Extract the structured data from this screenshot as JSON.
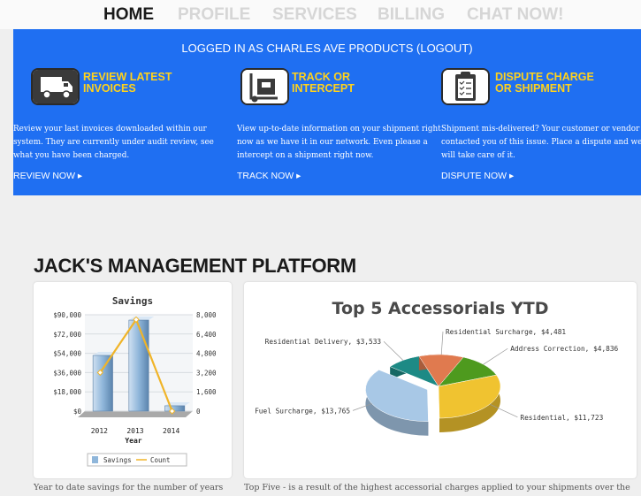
{
  "nav": {
    "items": [
      "HOME",
      "PROFILE",
      "SERVICES",
      "BILLING",
      "CHAT NOW!"
    ]
  },
  "band": {
    "logged_in_text": "LOGGED IN AS CHARLES AVE PRODUCTS (",
    "logout_label": "LOGOUT",
    "logged_in_end": ")",
    "columns": [
      {
        "icon": "delivery-truck-icon",
        "title_line1": "REVIEW LATEST",
        "title_line2": "INVOICES",
        "desc": "Review your last invoices downloaded within our system.  They are currently under audit review, see what you have been charged.",
        "link": "REVIEW NOW ▸"
      },
      {
        "icon": "hand-truck-icon",
        "title_line1": "TRACK OR",
        "title_line2": "INTERCEPT",
        "desc": "View up-to-date information on your shipment right now as we have it in our network.  Even please a intercept on a shipment right now.",
        "link": "TRACK NOW ▸"
      },
      {
        "icon": "clipboard-checklist-icon",
        "title_line1": "DISPUTE CHARGE",
        "title_line2": "OR SHIPMENT",
        "desc": "Shipment mis-delivered?  Your customer or vendor contacted you of this issue.  Place a dispute and we will take care of it.",
        "link": "DISPUTE NOW ▸"
      }
    ]
  },
  "platform_title": "JACK'S MANAGEMENT  PLATFORM",
  "colors": {
    "blue": "#1f6ff2",
    "yellow": "#ffd21c",
    "bar": "#8fb6da",
    "line": "#f0b428"
  },
  "chart_data": [
    {
      "type": "bar",
      "title": "Savings",
      "xlabel": "Year",
      "categories": [
        "2012",
        "2013",
        "2014"
      ],
      "y_left_ticks": [
        "$90,000",
        "$72,000",
        "$54,000",
        "$36,000",
        "$18,000",
        "$0"
      ],
      "y_right_ticks": [
        "8,000",
        "6,400",
        "4,800",
        "3,200",
        "1,600",
        "0"
      ],
      "ylim": [
        0,
        90000
      ],
      "y2lim": [
        0,
        8000
      ],
      "series": [
        {
          "name": "Savings",
          "values": [
            52000,
            85000,
            5000
          ]
        },
        {
          "name": "Count",
          "values": [
            3200,
            7600,
            0
          ]
        }
      ],
      "legend": [
        "Savings",
        "Count"
      ]
    },
    {
      "type": "pie",
      "title": "Top 5 Accessorials YTD",
      "slices": [
        {
          "label": "Residential Delivery, $3,533",
          "value": 3533,
          "color": "#1d8a85"
        },
        {
          "label": "Residential Surcharge, $4,481",
          "value": 4481,
          "color": "#e07a4f"
        },
        {
          "label": "Address Correction, $4,836",
          "value": 4836,
          "color": "#4e9a1e"
        },
        {
          "label": "Residential, $11,723",
          "value": 11723,
          "color": "#f0c330"
        },
        {
          "label": "Fuel Surcharge, $13,765",
          "value": 13765,
          "color": "#a8c8e6"
        }
      ]
    }
  ],
  "footer": {
    "left": "Year to date savings for the number of years",
    "right": "Top Five - is a result of the highest accessorial charges applied to your shipments over the"
  }
}
